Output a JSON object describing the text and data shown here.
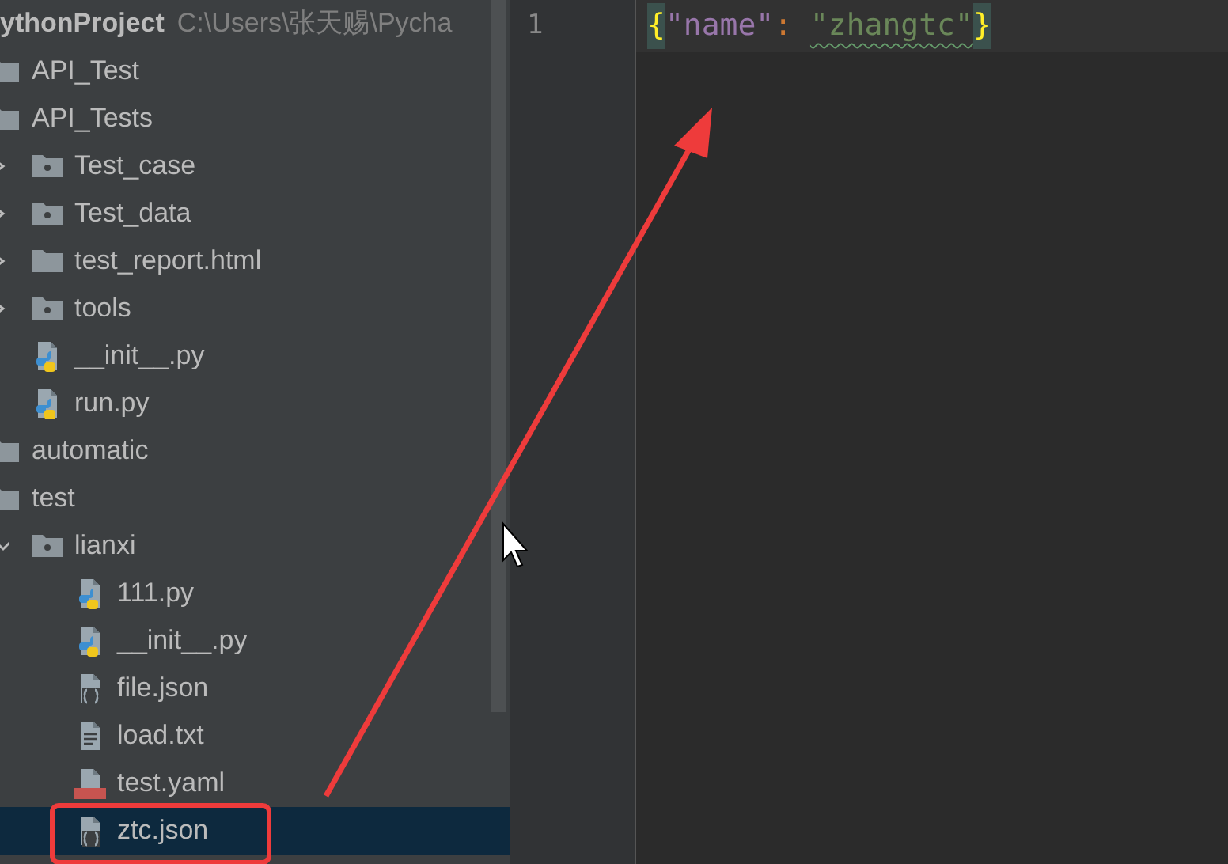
{
  "project": {
    "name": "ythonProject",
    "path": "C:\\Users\\张天赐\\Pycha"
  },
  "tree": [
    {
      "label": "API_Test",
      "kind": "folder"
    },
    {
      "label": "API_Tests",
      "kind": "folder",
      "children": [
        {
          "label": "Test_case",
          "kind": "package",
          "expanded": false
        },
        {
          "label": "Test_data",
          "kind": "package",
          "expanded": false
        },
        {
          "label": "test_report.html",
          "kind": "folder",
          "expanded": false
        },
        {
          "label": "tools",
          "kind": "package",
          "expanded": false
        },
        {
          "label": "__init__.py",
          "kind": "python"
        },
        {
          "label": "run.py",
          "kind": "python"
        }
      ]
    },
    {
      "label": "automatic",
      "kind": "folder"
    },
    {
      "label": "test",
      "kind": "folder",
      "children": [
        {
          "label": "lianxi",
          "kind": "package",
          "expanded": true,
          "children": [
            {
              "label": "111.py",
              "kind": "python",
              "selected": false
            },
            {
              "label": "__init__.py",
              "kind": "python",
              "selected": false
            },
            {
              "label": "file.json",
              "kind": "json",
              "selected": false
            },
            {
              "label": "load.txt",
              "kind": "text",
              "selected": false
            },
            {
              "label": "test.yaml",
              "kind": "yaml",
              "selected": false
            },
            {
              "label": "ztc.json",
              "kind": "json",
              "selected": true,
              "circled": true
            }
          ]
        }
      ]
    }
  ],
  "editor": {
    "lines": [
      {
        "number": "1",
        "tokens": [
          {
            "kind": "brace",
            "text": "{",
            "matched": true
          },
          {
            "kind": "key",
            "text": "\"name\""
          },
          {
            "kind": "colon",
            "text": ": "
          },
          {
            "kind": "string",
            "text": "\"zhangtc\"",
            "misspelled": true
          },
          {
            "kind": "brace",
            "text": "}",
            "matched": true
          }
        ]
      }
    ]
  },
  "annotation_arrow": true
}
